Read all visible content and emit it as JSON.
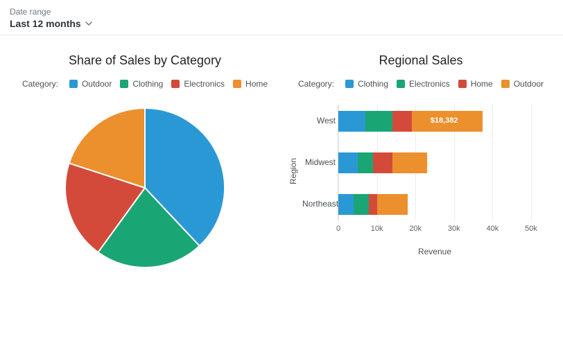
{
  "header": {
    "label": "Date range",
    "value": "Last 12 months"
  },
  "colors": {
    "blue": "#2b98d6",
    "green": "#1aa574",
    "red": "#d44a3a",
    "orange": "#ec8f2d"
  },
  "pie": {
    "title": "Share of Sales by Category",
    "legend_label": "Category:",
    "legend_order": [
      "Outdoor",
      "Clothing",
      "Electronics",
      "Home"
    ],
    "legend_colors": {
      "Outdoor": "blue",
      "Clothing": "green",
      "Electronics": "red",
      "Home": "orange"
    }
  },
  "bars": {
    "title": "Regional Sales",
    "legend_label": "Category:",
    "legend_order": [
      "Clothing",
      "Electronics",
      "Home",
      "Outdoor"
    ],
    "legend_colors": {
      "Clothing": "blue",
      "Electronics": "green",
      "Home": "red",
      "Outdoor": "orange"
    },
    "ylabel": "Region",
    "xlabel": "Revenue",
    "xticks": [
      "0",
      "10k",
      "20k",
      "30k",
      "40k",
      "50k"
    ],
    "xmax": 50000,
    "data_label_text": "$18,382"
  },
  "chart_data": [
    {
      "type": "pie",
      "title": "Share of Sales by Category",
      "categories": [
        "Outdoor",
        "Clothing",
        "Electronics",
        "Home"
      ],
      "values": [
        38,
        22,
        20,
        20
      ],
      "units": "percent",
      "note": "Visual estimate of slice shares. Colors: Outdoor=blue, Clothing=green, Electronics=red, Home=orange."
    },
    {
      "type": "bar",
      "orientation": "horizontal",
      "stacked": true,
      "title": "Regional Sales",
      "xlabel": "Revenue",
      "ylabel": "Region",
      "xlim": [
        0,
        50000
      ],
      "categories": [
        "West",
        "Midwest",
        "Northeast"
      ],
      "series": [
        {
          "name": "Clothing",
          "values": [
            7000,
            5000,
            4000
          ]
        },
        {
          "name": "Electronics",
          "values": [
            7000,
            4000,
            4000
          ]
        },
        {
          "name": "Home",
          "values": [
            5000,
            5000,
            2000
          ]
        },
        {
          "name": "Outdoor",
          "values": [
            18382,
            9000,
            8000
          ]
        }
      ],
      "data_labels": [
        {
          "region": "West",
          "series": "Outdoor",
          "text": "$18,382"
        }
      ]
    }
  ]
}
